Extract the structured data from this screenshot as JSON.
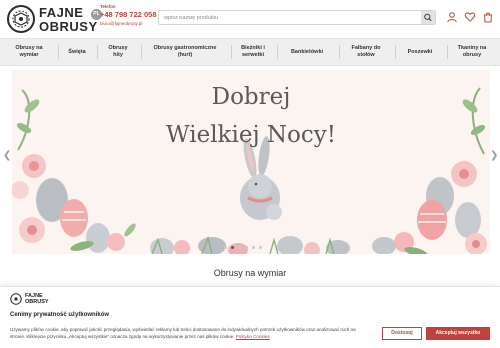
{
  "header": {
    "logo_line1": "FAJNE",
    "logo_line2": "OBRUSY",
    "logo_badge": "PL",
    "phone_label": "Telefon",
    "phone": "+48 798 722 058",
    "email": "biuro@fajneobrusy.pl",
    "search_placeholder": "wpisz nazwę produktu",
    "icons": [
      "search-icon",
      "user-icon",
      "heart-icon",
      "cart-icon"
    ]
  },
  "nav": {
    "items": [
      {
        "line1": "Obrusy na",
        "line2": "wymiar"
      },
      {
        "line1": "Święta",
        "line2": ""
      },
      {
        "line1": "Obrusy",
        "line2": "hity"
      },
      {
        "line1": "Obrusy gastronomiczne",
        "line2": "(hurt)"
      },
      {
        "line1": "Bieżniki i",
        "line2": "serwetki"
      },
      {
        "line1": "Bankietówki",
        "line2": ""
      },
      {
        "line1": "Falbany do",
        "line2": "stołów"
      },
      {
        "line1": "Poszewki",
        "line2": ""
      },
      {
        "line1": "Tkaniny na",
        "line2": "obrusy"
      }
    ]
  },
  "banner": {
    "line1": "Dobrej",
    "line2": "Wielkiej Nocy!",
    "slides_total": 6,
    "active_slide": 1
  },
  "section": {
    "title": "Obrusy na wymiar"
  },
  "cookie": {
    "logo_line1": "FAJNE",
    "logo_line2": "OBRUSY",
    "title": "Cenimy prywatność użytkowników",
    "body1": "Używamy plików cookie, aby poprawić jakość przeglądania, wyświetlać reklamy lub treści dostosowane do indywidualnych potrzeb użytkowników oraz",
    "body2": "analizować ruch na stronie. Kliknięcie przycisku „Akceptuj wszystkie” oznacza zgodę na wykorzystywanie przez nas plików cookie.",
    "policy_link": "Polityka Cookies",
    "reject_label": "Dostosuj",
    "accept_label": "Akceptuj wszystko"
  },
  "colors": {
    "accent": "#c2413a",
    "nav_bg": "#efefef"
  }
}
